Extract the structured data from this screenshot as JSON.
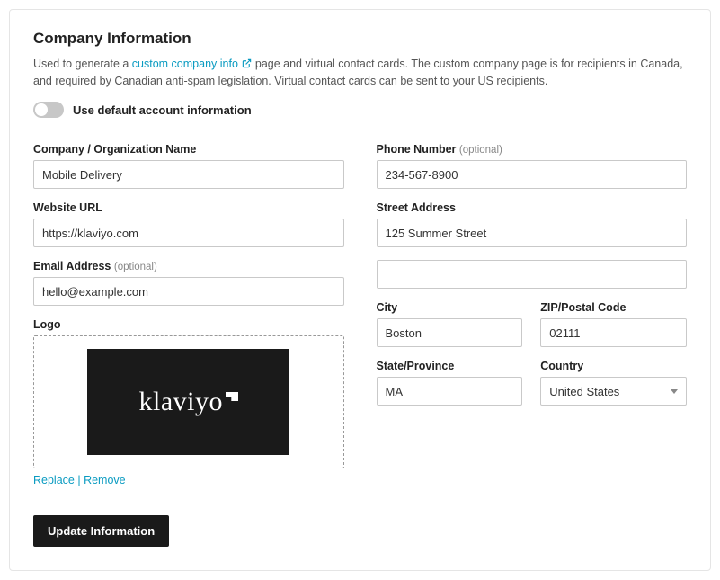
{
  "header": {
    "title": "Company Information",
    "desc_before": "Used to generate a ",
    "desc_link": "custom company info",
    "desc_after": " page and virtual contact cards. The custom company page is for recipients in Canada, and required by Canadian anti-spam legislation. Virtual contact cards can be sent to your US recipients."
  },
  "toggle": {
    "label": "Use default account information"
  },
  "fields": {
    "company_label": "Company / Organization Name",
    "company_value": "Mobile Delivery",
    "website_label": "Website URL",
    "website_value": "https://klaviyo.com",
    "email_label": "Email Address",
    "email_optional": "(optional)",
    "email_value": "hello@example.com",
    "logo_label": "Logo",
    "logo_text": "klaviyo",
    "replace": "Replace",
    "remove": "Remove",
    "phone_label": "Phone Number",
    "phone_optional": "(optional)",
    "phone_value": "234-567-8900",
    "street_label": "Street Address",
    "street_value": "125 Summer Street",
    "street2_value": "",
    "city_label": "City",
    "city_value": "Boston",
    "zip_label": "ZIP/Postal Code",
    "zip_value": "02111",
    "state_label": "State/Province",
    "state_value": "MA",
    "country_label": "Country",
    "country_value": "United States"
  },
  "actions": {
    "update": "Update Information"
  }
}
